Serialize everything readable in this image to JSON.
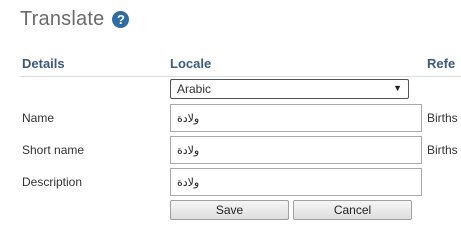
{
  "page": {
    "title": "Translate",
    "help_icon": "?"
  },
  "columns": {
    "details": "Details",
    "locale": "Locale",
    "reference": "Refe"
  },
  "locale_select": {
    "selected": "Arabic",
    "arrow_icon": "▼"
  },
  "rows": [
    {
      "label": "Name",
      "value": "ولادة",
      "reference": "Births"
    },
    {
      "label": "Short name",
      "value": "ولادة",
      "reference": "Births"
    },
    {
      "label": "Description",
      "value": "ولادة",
      "reference": ""
    }
  ],
  "buttons": {
    "save": "Save",
    "cancel": "Cancel"
  },
  "colors": {
    "header_text": "#3c5a80",
    "help_icon_bg": "#2e6da4",
    "title_text": "#6b6b6b"
  }
}
